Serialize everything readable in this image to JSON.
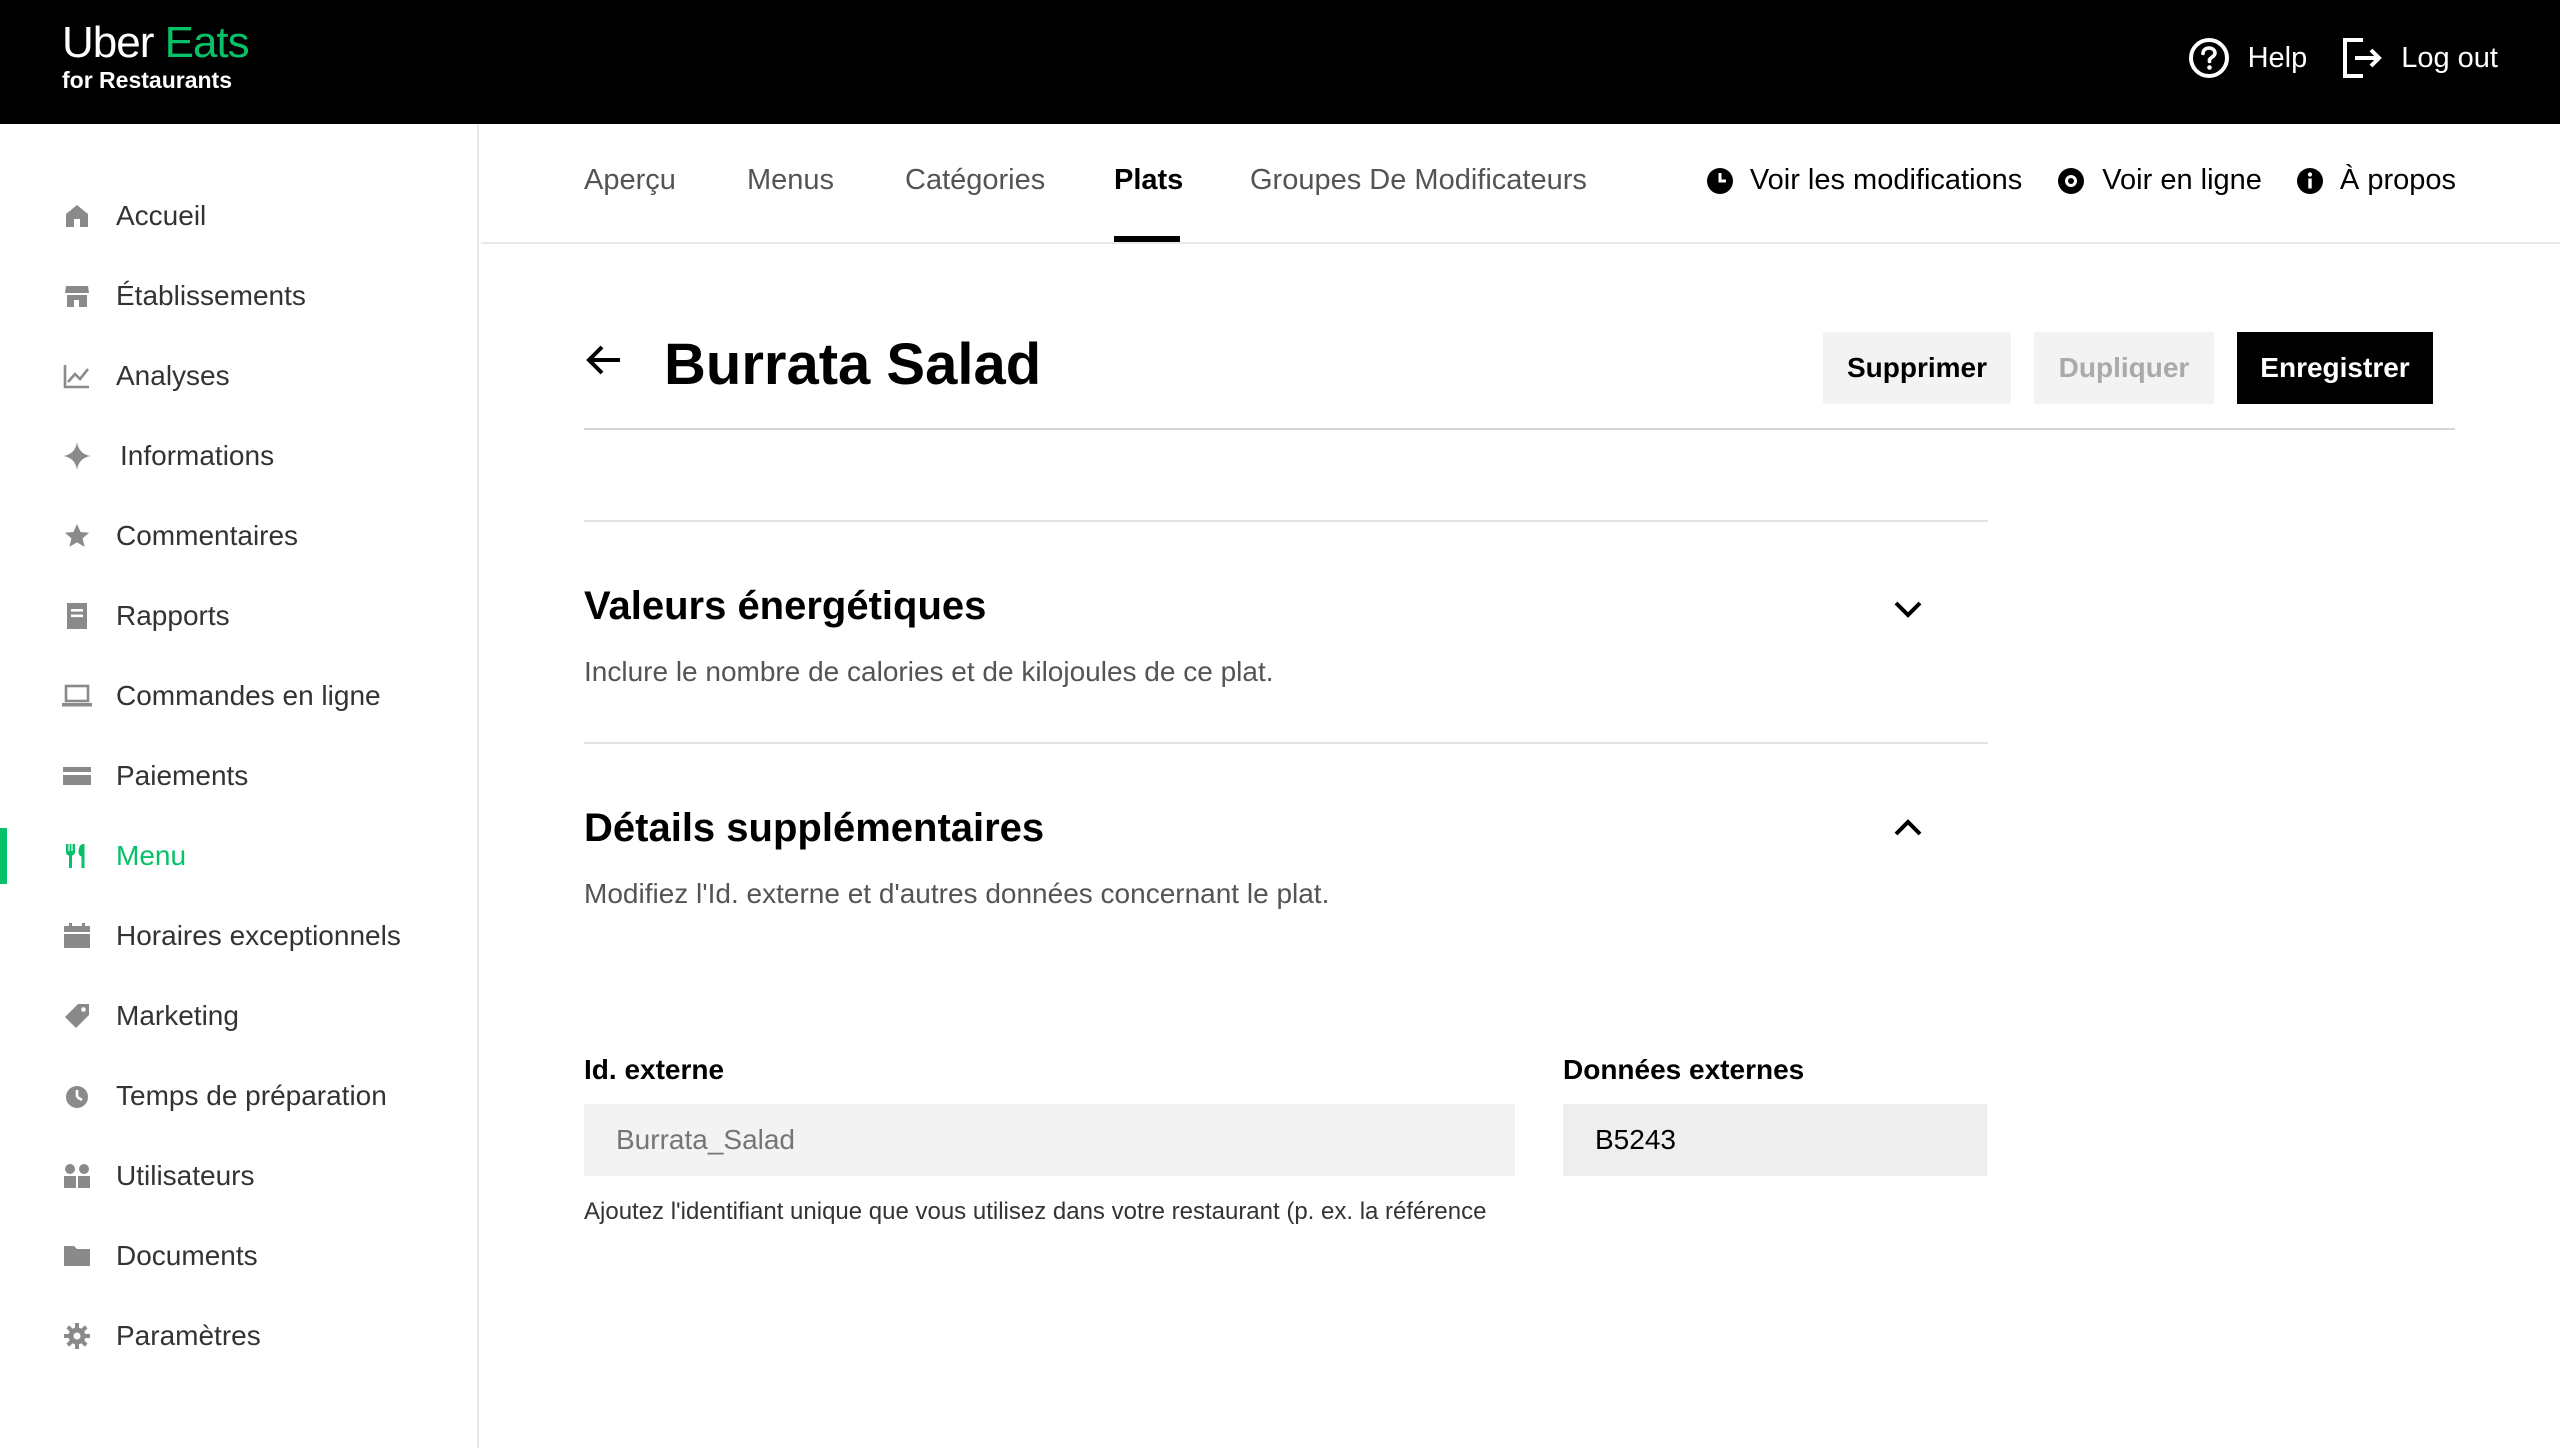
{
  "brand": {
    "name_part1": "Uber",
    "name_part2": "Eats",
    "subtitle": "for Restaurants",
    "accent_color": "#06c167"
  },
  "top_actions": {
    "help_label": "Help",
    "help_icon": "help-circle-icon",
    "logout_label": "Log out",
    "logout_icon": "logout-icon"
  },
  "sidebar": {
    "items": [
      {
        "label": "Accueil",
        "icon": "home-icon"
      },
      {
        "label": "Établissements",
        "icon": "store-icon"
      },
      {
        "label": "Analyses",
        "icon": "chart-icon"
      },
      {
        "label": "Informations",
        "icon": "sparkle-icon"
      },
      {
        "label": "Commentaires",
        "icon": "star-icon"
      },
      {
        "label": "Rapports",
        "icon": "report-icon"
      },
      {
        "label": "Commandes en ligne",
        "icon": "laptop-icon"
      },
      {
        "label": "Paiements",
        "icon": "card-icon"
      },
      {
        "label": "Menu",
        "icon": "utensils-icon",
        "active": true
      },
      {
        "label": "Horaires exceptionnels",
        "icon": "calendar-icon"
      },
      {
        "label": "Marketing",
        "icon": "tag-icon"
      },
      {
        "label": "Temps de préparation",
        "icon": "timer-icon"
      },
      {
        "label": "Utilisateurs",
        "icon": "users-icon"
      },
      {
        "label": "Documents",
        "icon": "folder-icon"
      },
      {
        "label": "Paramètres",
        "icon": "gear-icon"
      }
    ]
  },
  "tabs": {
    "items": [
      {
        "label": "Aperçu"
      },
      {
        "label": "Menus"
      },
      {
        "label": "Catégories"
      },
      {
        "label": "Plats",
        "active": true
      },
      {
        "label": "Groupes De Modificateurs"
      }
    ],
    "actions": {
      "changes_label": "Voir les modifications",
      "online_label": "Voir en ligne",
      "about_label": "À propos"
    }
  },
  "page": {
    "title": "Burrata Salad",
    "buttons": {
      "delete": "Supprimer",
      "duplicate": "Dupliquer",
      "save": "Enregistrer"
    }
  },
  "sections": {
    "energy": {
      "title": "Valeurs énergétiques",
      "description": "Inclure le nombre de calories et de kilojoules de ce plat.",
      "expanded": false
    },
    "details": {
      "title": "Détails supplémentaires",
      "description": "Modifiez l'Id. externe et d'autres données concernant le plat.",
      "expanded": true
    }
  },
  "fields": {
    "external_id": {
      "label": "Id. externe",
      "placeholder": "Burrata_Salad",
      "helper": "Ajoutez l'identifiant unique que vous utilisez dans votre restaurant (p. ex. la référence"
    },
    "external_data": {
      "label": "Données externes",
      "value": "B5243"
    }
  }
}
